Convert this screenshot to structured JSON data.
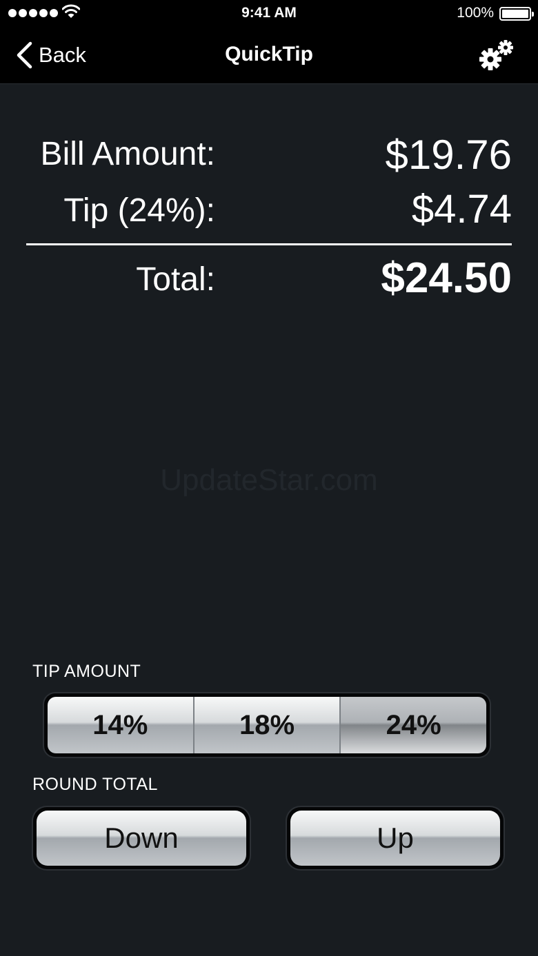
{
  "status_bar": {
    "time": "9:41 AM",
    "battery_percent": "100%",
    "signal_bars": 5,
    "icons": [
      "signal-dots-icon",
      "wifi-icon",
      "battery-icon"
    ]
  },
  "nav": {
    "back_label": "Back",
    "title": "QuickTip",
    "settings_icon": "gear-icon"
  },
  "amounts": {
    "bill_label": "Bill Amount:",
    "bill_value": "$19.76",
    "tip_label": "Tip (24%):",
    "tip_value": "$4.74",
    "total_label": "Total:",
    "total_value": "$24.50"
  },
  "watermark": "UpdateStar.com",
  "tip_amount": {
    "label": "TIP AMOUNT",
    "options": [
      "14%",
      "18%",
      "24%"
    ],
    "selected": "24%"
  },
  "round_total": {
    "label": "ROUND TOTAL",
    "down_label": "Down",
    "up_label": "Up"
  },
  "colors": {
    "background": "#181c20",
    "bar": "#000000",
    "text": "#ffffff"
  }
}
